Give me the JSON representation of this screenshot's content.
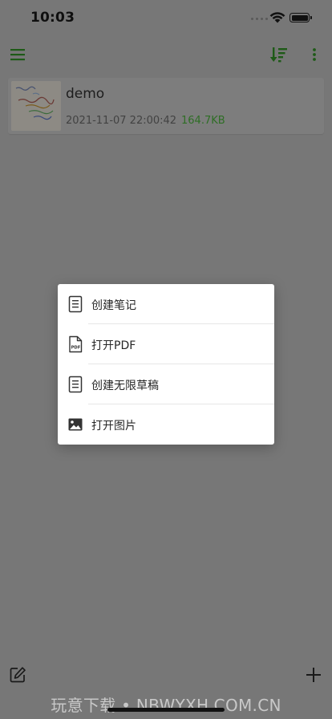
{
  "status_bar": {
    "time": "10:03"
  },
  "toolbar": {
    "menu_icon": "hamburger-icon",
    "sort_icon": "sort-icon",
    "more_icon": "more-vertical-icon",
    "accent": "#1e5a17"
  },
  "notes": [
    {
      "title": "demo",
      "date": "2021-11-07 22:00:42",
      "size": "164.7KB"
    }
  ],
  "popup": {
    "items": [
      {
        "label": "创建笔记",
        "icon": "document-icon"
      },
      {
        "label": "打开PDF",
        "icon": "pdf-file-icon"
      },
      {
        "label": "创建无限草稿",
        "icon": "document-icon"
      },
      {
        "label": "打开图片",
        "icon": "image-icon"
      }
    ]
  },
  "bottom_bar": {
    "edit_icon": "edit-icon",
    "add_icon": "plus-icon"
  },
  "watermark": "玩意下载 • NBWYXH.COM.CN"
}
